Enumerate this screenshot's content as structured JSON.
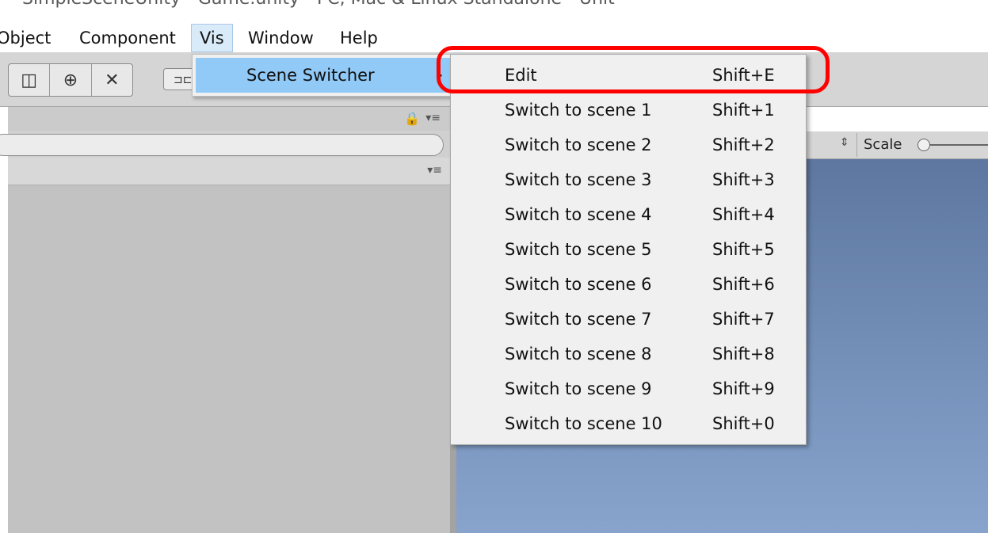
{
  "window": {
    "title": "SimpleSceneUnity - Game.unity - PC, Mac & Linux Standalone - Unit"
  },
  "menubar": {
    "items": [
      "Object",
      "Component",
      "Vis",
      "Window",
      "Help"
    ]
  },
  "toolbar": {
    "pivot_label": "⊐⊏"
  },
  "right_header": {
    "scale_label": "Scale",
    "scale_arrows": "⇕"
  },
  "submenu": {
    "label": "Scene Switcher",
    "arrow": "›"
  },
  "dropdown": {
    "items": [
      {
        "label": "Edit",
        "shortcut": "Shift+E"
      },
      {
        "label": "Switch to scene 1",
        "shortcut": "Shift+1"
      },
      {
        "label": "Switch to scene 2",
        "shortcut": "Shift+2"
      },
      {
        "label": "Switch to scene 3",
        "shortcut": "Shift+3"
      },
      {
        "label": "Switch to scene 4",
        "shortcut": "Shift+4"
      },
      {
        "label": "Switch to scene 5",
        "shortcut": "Shift+5"
      },
      {
        "label": "Switch to scene 6",
        "shortcut": "Shift+6"
      },
      {
        "label": "Switch to scene 7",
        "shortcut": "Shift+7"
      },
      {
        "label": "Switch to scene 8",
        "shortcut": "Shift+8"
      },
      {
        "label": "Switch to scene 9",
        "shortcut": "Shift+9"
      },
      {
        "label": "Switch to scene 10",
        "shortcut": "Shift+0"
      }
    ]
  },
  "icons": {
    "rect_tool": "◫",
    "transform_tool": "⊕",
    "tools_tool": "✕",
    "lock": "🔒",
    "panel_menu": "▾≡"
  },
  "colors": {
    "highlight": "#ff0000",
    "menu_hover": "#91c9f7",
    "game_view": "#6f8bb5"
  }
}
